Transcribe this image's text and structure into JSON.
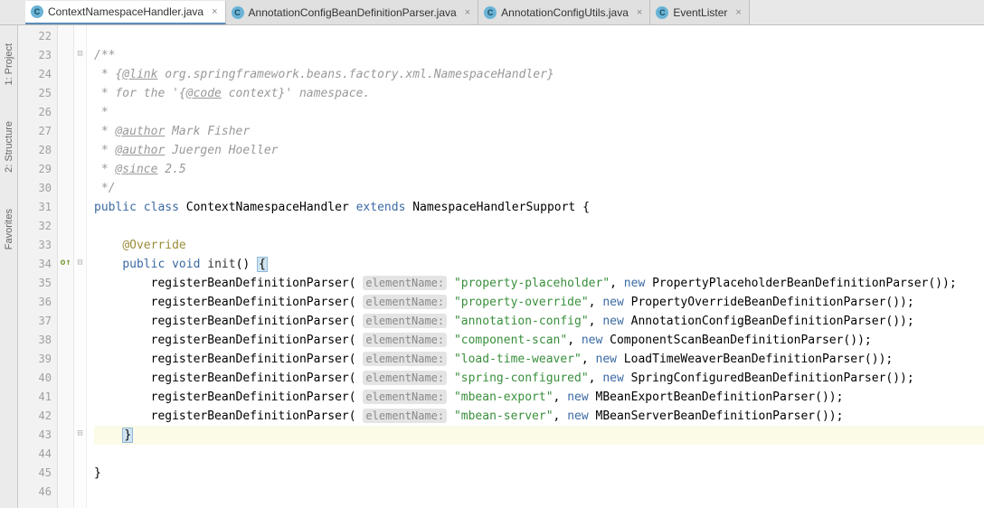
{
  "tabs": [
    {
      "label": "ContextNamespaceHandler.java",
      "active": true
    },
    {
      "label": "AnnotationConfigBeanDefinitionParser.java",
      "active": false
    },
    {
      "label": "AnnotationConfigUtils.java",
      "active": false
    },
    {
      "label": "EventLister",
      "active": false
    }
  ],
  "sidebar": {
    "project": "1: Project",
    "structure": "2: Structure",
    "favorites": "Favorites"
  },
  "code": {
    "lines": [
      {
        "n": 22,
        "html": ""
      },
      {
        "n": 23,
        "html": "<span class='comment'>/**</span>",
        "fold": "⊟"
      },
      {
        "n": 24,
        "html": "<span class='comment'> * {</span><span class='doc-tag'>@link</span><span class='comment'> org.springframework.beans.factory.xml.NamespaceHandler}</span>"
      },
      {
        "n": 25,
        "html": "<span class='comment'> * for the '{</span><span class='doc-tag'>@code</span><span class='comment'> context}' namespace.</span>"
      },
      {
        "n": 26,
        "html": "<span class='comment'> *</span>"
      },
      {
        "n": 27,
        "html": "<span class='comment'> * </span><span class='doc-tag'>@author</span><span class='comment'> Mark Fisher</span>"
      },
      {
        "n": 28,
        "html": "<span class='comment'> * </span><span class='doc-tag'>@author</span><span class='comment'> Juergen Hoeller</span>"
      },
      {
        "n": 29,
        "html": "<span class='comment'> * </span><span class='doc-tag'>@since</span><span class='comment'> 2.5</span>"
      },
      {
        "n": 30,
        "html": "<span class='comment'> */</span>"
      },
      {
        "n": 31,
        "html": "<span class='kw1'>public</span> <span class='kw1'>class</span> ContextNamespaceHandler <span class='kw1'>extends</span> NamespaceHandlerSupport {"
      },
      {
        "n": 32,
        "html": ""
      },
      {
        "n": 33,
        "html": "    <span class='ann'>@Override</span>"
      },
      {
        "n": 34,
        "html": "    <span class='kw1'>public</span> <span class='kw1'>void</span> <span class='methname'>init</span>() <span class='caret-bg'>{</span>",
        "mark": "o↑",
        "fold": "⊟"
      },
      {
        "n": 35,
        "html": "        registerBeanDefinitionParser( <span class='paramhint'>elementName:</span> <span class='string'>\"property-placeholder\"</span>, <span class='kw1'>new</span> PropertyPlaceholderBeanDefinitionParser());"
      },
      {
        "n": 36,
        "html": "        registerBeanDefinitionParser( <span class='paramhint'>elementName:</span> <span class='string'>\"property-override\"</span>, <span class='kw1'>new</span> PropertyOverrideBeanDefinitionParser());"
      },
      {
        "n": 37,
        "html": "        registerBeanDefinitionParser( <span class='paramhint'>elementName:</span> <span class='string'>\"annotation-config\"</span>, <span class='kw1'>new</span> AnnotationConfigBeanDefinitionParser());"
      },
      {
        "n": 38,
        "html": "        registerBeanDefinitionParser( <span class='paramhint'>elementName:</span> <span class='string'>\"component-scan\"</span>, <span class='kw1'>new</span> ComponentScanBeanDefinitionParser());"
      },
      {
        "n": 39,
        "html": "        registerBeanDefinitionParser( <span class='paramhint'>elementName:</span> <span class='string'>\"load-time-weaver\"</span>, <span class='kw1'>new</span> LoadTimeWeaverBeanDefinitionParser());"
      },
      {
        "n": 40,
        "html": "        registerBeanDefinitionParser( <span class='paramhint'>elementName:</span> <span class='string'>\"spring-configured\"</span>, <span class='kw1'>new</span> SpringConfiguredBeanDefinitionParser());"
      },
      {
        "n": 41,
        "html": "        registerBeanDefinitionParser( <span class='paramhint'>elementName:</span> <span class='string'>\"mbean-export\"</span>, <span class='kw1'>new</span> MBeanExportBeanDefinitionParser());"
      },
      {
        "n": 42,
        "html": "        registerBeanDefinitionParser( <span class='paramhint'>elementName:</span> <span class='string'>\"mbean-server\"</span>, <span class='kw1'>new</span> MBeanServerBeanDefinitionParser());"
      },
      {
        "n": 43,
        "html": "    <span class='caret-bg'>}</span>",
        "hl": true,
        "fold": "⊟"
      },
      {
        "n": 44,
        "html": ""
      },
      {
        "n": 45,
        "html": "}"
      },
      {
        "n": 46,
        "html": ""
      }
    ]
  }
}
